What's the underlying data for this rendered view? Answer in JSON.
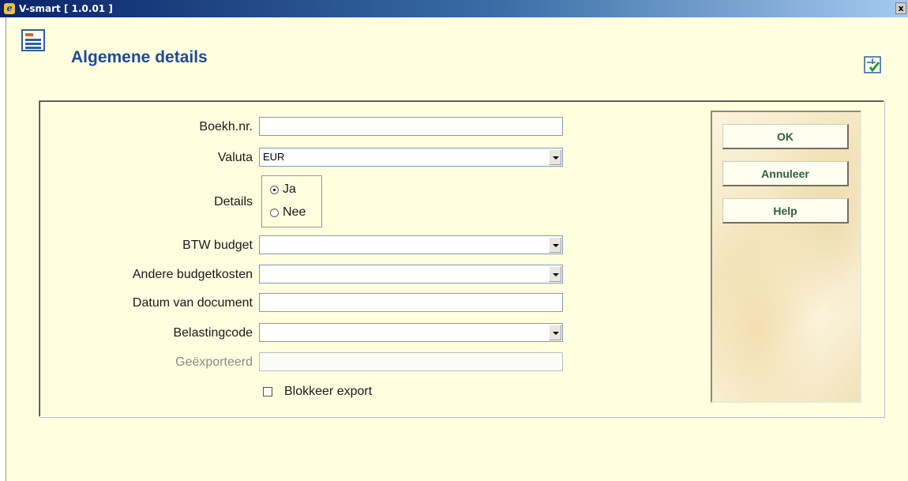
{
  "window": {
    "title": "V-smart [ 1.0.01 ]",
    "close_glyph": "x"
  },
  "header": {
    "title": "Algemene details",
    "page_icon": "form-list-icon",
    "help_icon": "tree-check-icon"
  },
  "form": {
    "boekh_nr": {
      "label": "Boekh.nr.",
      "value": ""
    },
    "valuta": {
      "label": "Valuta",
      "value": "EUR"
    },
    "details": {
      "label": "Details",
      "options": [
        "Ja",
        "Nee"
      ],
      "selected": "Ja"
    },
    "btw_budget": {
      "label": "BTW budget",
      "value": ""
    },
    "andere_budgetkosten": {
      "label": "Andere budgetkosten",
      "value": ""
    },
    "datum_van_document": {
      "label": "Datum van document",
      "value": ""
    },
    "belastingcode": {
      "label": "Belastingcode",
      "value": ""
    },
    "geexporteerd": {
      "label": "Geëxporteerd",
      "value": ""
    },
    "blokkeer_export": {
      "label": "Blokkeer export",
      "checked": false
    }
  },
  "buttons": {
    "ok": "OK",
    "cancel": "Annuleer",
    "help": "Help"
  },
  "colors": {
    "title_blue": "#1e4b9b",
    "background": "#ffffe0",
    "button_text": "#2f5f3f"
  }
}
